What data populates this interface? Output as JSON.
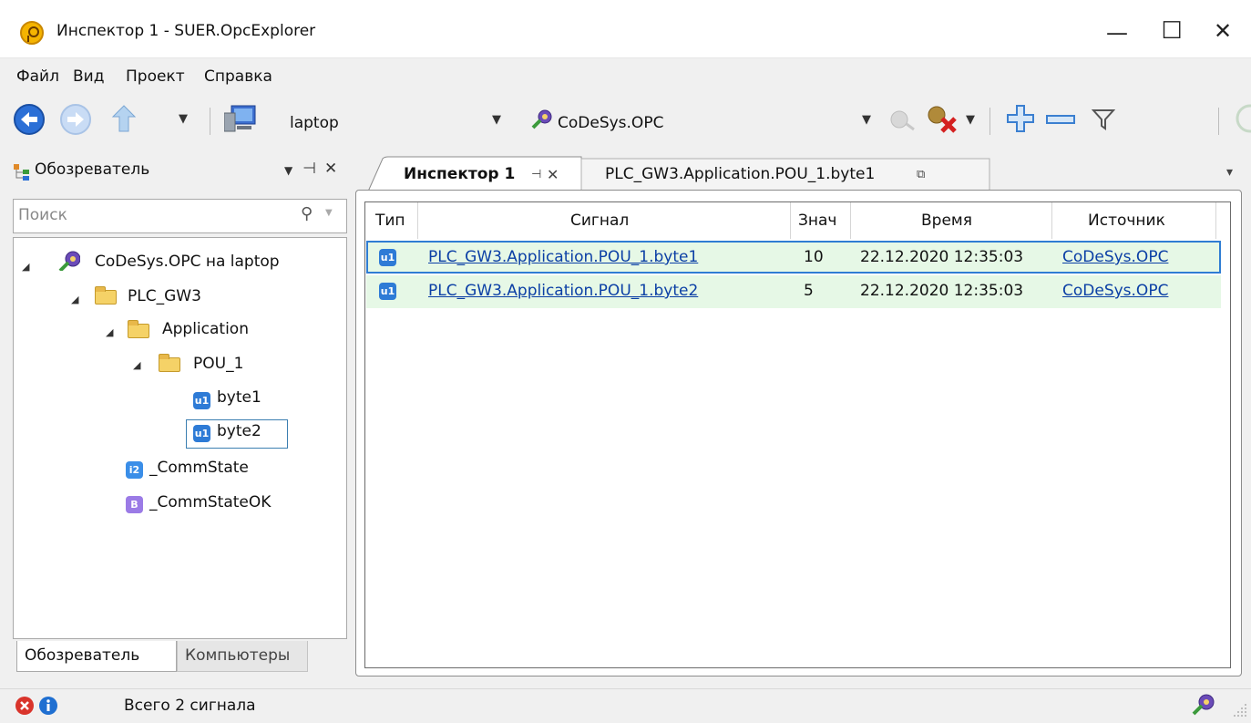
{
  "window": {
    "title": "Инспектор 1 - SUER.OpcExplorer",
    "minimize": "—",
    "maximize": "☐",
    "close": "✕"
  },
  "menu": [
    "Файл",
    "Вид",
    "Проект",
    "Справка"
  ],
  "toolbar": {
    "computer_combo": "laptop",
    "server_combo": "CoDeSys.OPC"
  },
  "explorer": {
    "title": "Обозреватель",
    "search_placeholder": "Поиск",
    "tree": {
      "root": "CoDeSys.OPC на laptop",
      "plc": "PLC_GW3",
      "app": "Application",
      "pou": "POU_1",
      "byte1": "byte1",
      "byte2": "byte2",
      "commstate": "_CommState",
      "commstateok": "_CommStateOK"
    },
    "badges": {
      "u": "u1",
      "i": "i2",
      "b": "B"
    },
    "bottom_tabs": [
      "Обозреватель",
      "Компьютеры"
    ]
  },
  "doc_tabs": [
    {
      "label": "Инспектор 1"
    },
    {
      "label": "PLC_GW3.Application.POU_1.byte1"
    }
  ],
  "grid": {
    "columns": [
      "Тип",
      "Сигнал",
      "Знач",
      "Время",
      "Источник"
    ],
    "rows": [
      {
        "type_badge": "u1",
        "signal": "PLC_GW3.Application.POU_1.byte1",
        "value": "10",
        "time": "22.12.2020 12:35:03",
        "source": "CoDeSys.OPC",
        "selected": true
      },
      {
        "type_badge": "u1",
        "signal": "PLC_GW3.Application.POU_1.byte2",
        "value": "5",
        "time": "22.12.2020 12:35:03",
        "source": "CoDeSys.OPC",
        "selected": false
      }
    ]
  },
  "status": {
    "text": "Всего 2 сигнала"
  },
  "colors": {
    "row_bg": "#e6f8e6",
    "selection_border": "#2f7dd3",
    "link": "#0b3fa5"
  }
}
